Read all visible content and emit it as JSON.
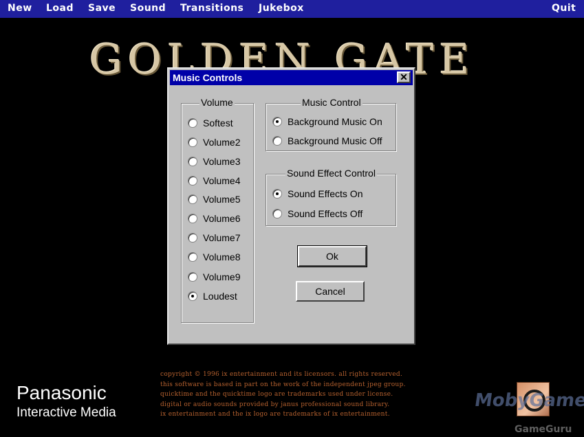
{
  "menubar": {
    "items": [
      "New",
      "Load",
      "Save",
      "Sound",
      "Transitions",
      "Jukebox"
    ],
    "quit": "Quit"
  },
  "background_title": "GOLDEN GATE",
  "dialog": {
    "title": "Music Controls",
    "close_glyph": "✕",
    "volume_group": {
      "label": "Volume",
      "options": [
        "Softest",
        "Volume2",
        "Volume3",
        "Volume4",
        "Volume5",
        "Volume6",
        "Volume7",
        "Volume8",
        "Volume9",
        "Loudest"
      ],
      "selected": "Loudest"
    },
    "music_group": {
      "label": "Music Control",
      "options": [
        "Background Music On",
        "Background Music Off"
      ],
      "selected": "Background Music On"
    },
    "sfx_group": {
      "label": "Sound Effect Control",
      "options": [
        "Sound Effects On",
        "Sound Effects Off"
      ],
      "selected": "Sound Effects On"
    },
    "ok_label": "Ok",
    "cancel_label": "Cancel"
  },
  "footer": {
    "brand_name": "Panasonic",
    "brand_sub": "Interactive Media",
    "copyright_lines": [
      "COPYRIGHT © 1996 IX ENTERTAINMENT AND ITS LICENSORS. ALL RIGHTS RESERVED.",
      "THIS SOFTWARE IS BASED IN PART ON THE WORK OF THE INDEPENDENT JPEG GROUP.",
      "QUICKTIME AND THE QUICKTIME LOGO ARE TRADEMARKS USED UNDER LICENSE.",
      "DIGITAL OR AUDIO SOUNDS PROVIDED BY JANUS PROFESSIONAL SOUND LIBRARY.",
      "IX ENTERTAINMENT AND THE IX LOGO ARE TRADEMARKS OF IX ENTERTAINMENT."
    ]
  },
  "watermark": {
    "line1": "MobyGames",
    "line2": "GameGuru"
  },
  "colors": {
    "menubar": "#1f1f9e",
    "dialog_face": "#c0c0c0",
    "titlebar": "#0000a8",
    "copyright_text": "#b8622f"
  }
}
